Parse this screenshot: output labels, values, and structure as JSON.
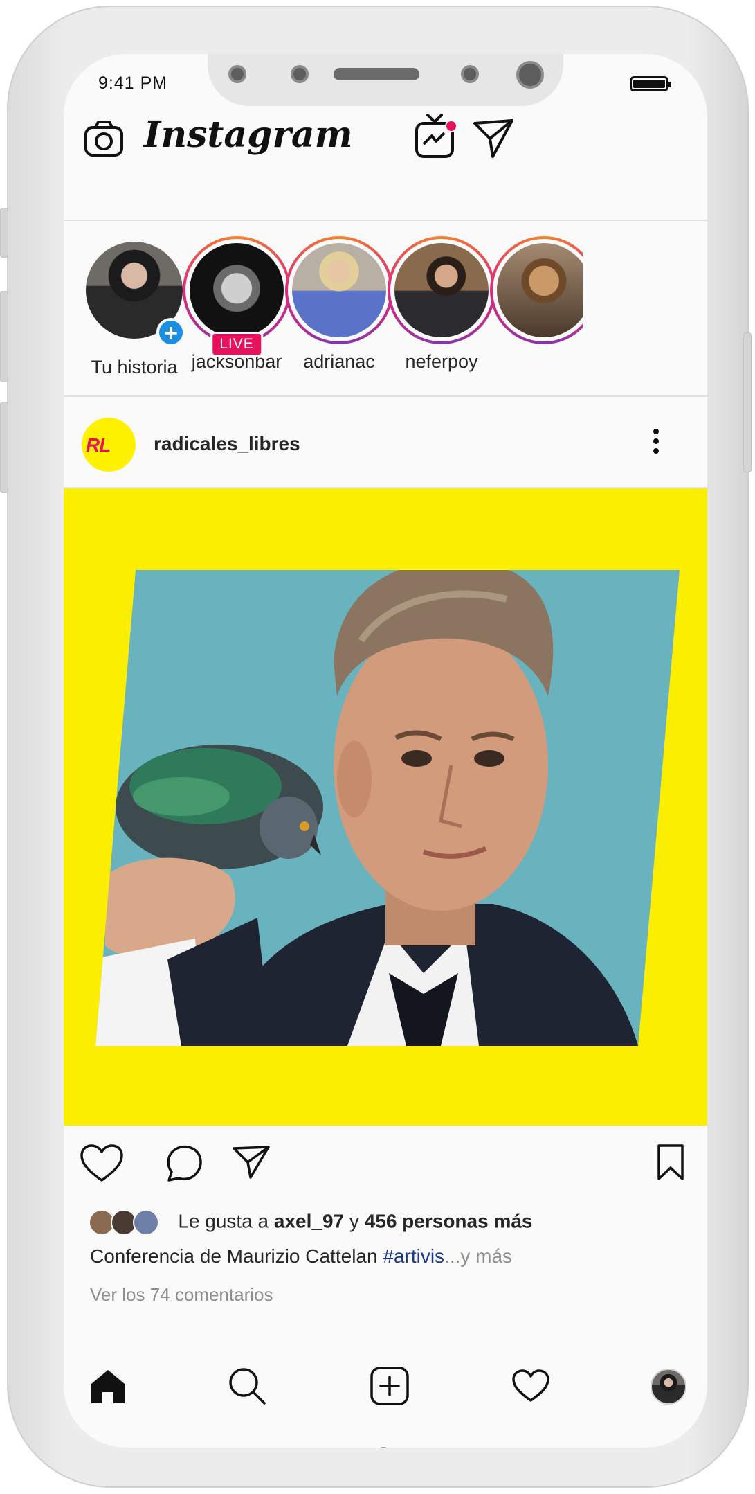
{
  "status_bar": {
    "time": "9:41 PM"
  },
  "header": {
    "app_name": "Instagram",
    "camera_icon": "camera-icon",
    "igtv_icon": "igtv-icon",
    "direct_icon": "paper-plane-icon"
  },
  "stories": [
    {
      "username": "Tu historia",
      "own": true
    },
    {
      "username": "jacksonbar",
      "live_label": "LIVE"
    },
    {
      "username": "adrianac"
    },
    {
      "username": "neferpoy"
    },
    {
      "username": ""
    }
  ],
  "post": {
    "username": "radicales_libres",
    "avatar_text": "RL",
    "likes_prefix": "Le gusta a",
    "liked_by": "axel_97",
    "likes_connector": "y",
    "likes_rest": "456 personas más",
    "caption_text": "Conferencia de Maurizio Cattelan",
    "caption_tag": "#artivis",
    "caption_more": "...y más",
    "comments_link": "Ver los 74 comentarios"
  },
  "colors": {
    "accent_yellow": "#fcee00",
    "live_red": "#e8125c",
    "hashtag_blue": "#1b3a8c",
    "add_blue": "#1a8fe3"
  }
}
